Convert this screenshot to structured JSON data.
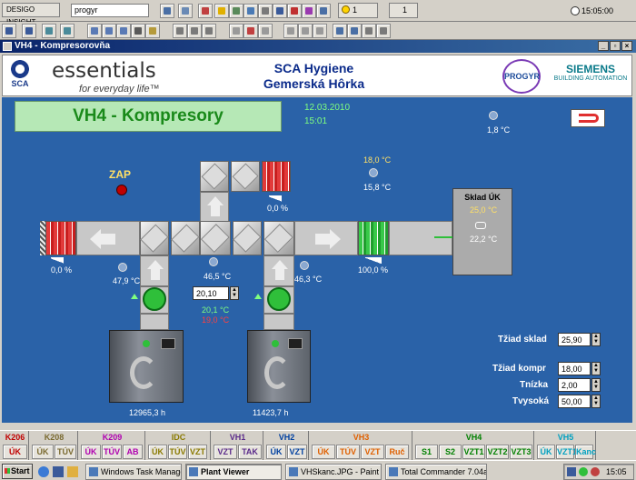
{
  "app": {
    "name": "DESIGO INSIGHT",
    "user": "progyr",
    "clock": "15:05:00",
    "alarm_count_1": "1",
    "alarm_count_2": "1"
  },
  "window": {
    "title": "VH4 - Kompresorovňa"
  },
  "header": {
    "company_line1": "SCA Hygiene",
    "company_line2": "Gemerská Hôrka",
    "essentials": "essentials",
    "tagline": "for everyday life™",
    "sca_logo": "SCA",
    "progyr_logo": "PROGYR",
    "siemens_line1": "SIEMENS",
    "siemens_line2": "BUILDING AUTOMATION"
  },
  "plant": {
    "title": "VH4 - Kompresory",
    "date": "12.03.2010",
    "time": "15:01",
    "outdoor_temp": "1,8 °C",
    "status": "ZAP",
    "damper_left": "0,0 %",
    "damper_top": "0,0 %",
    "damper_right": "100,0 %",
    "temp_top_set": "18,0 °C",
    "temp_top": "15,8 °C",
    "temp_left": "47,9 °C",
    "temp_mid": "46,5 °C",
    "temp_right": "46,3 °C",
    "mix_setpoint": "20,10",
    "mix_green": "20,1 °C",
    "mix_red": "19,0 °C",
    "storage_title": "Sklad ÚK",
    "storage_set": "25,0 °C",
    "storage_temp": "22,2 °C",
    "comp1_hours": "12965,3 h",
    "comp2_hours": "11423,7 h",
    "setpoints": [
      {
        "label": "Tžiad sklad",
        "value": "25,90"
      },
      {
        "label": "Tžiad kompr",
        "value": "18,00"
      },
      {
        "label": "Tnízka",
        "value": "2,00"
      },
      {
        "label": "Tvysoká",
        "value": "50,00"
      }
    ]
  },
  "footer": {
    "groups": [
      {
        "name": "K206",
        "color": "#c00000",
        "items": [
          "ÚK"
        ]
      },
      {
        "name": "K208",
        "color": "#7a6a30",
        "items": [
          "ÚK",
          "TÚV"
        ]
      },
      {
        "name": "K209",
        "color": "#b000b0",
        "items": [
          "ÚK",
          "TÚV",
          "AB"
        ]
      },
      {
        "name": "IDC",
        "color": "#8a7a00",
        "items": [
          "ÚK",
          "TÚV",
          "VZT"
        ]
      },
      {
        "name": "VH1",
        "color": "#5a2a8a",
        "items": [
          "VZT",
          "TAK"
        ]
      },
      {
        "name": "VH2",
        "color": "#0040a0",
        "items": [
          "ÚK",
          "VZT"
        ]
      },
      {
        "name": "VH3",
        "color": "#e06000",
        "items": [
          "ÚK",
          "TÚV",
          "VZT",
          "Ruč"
        ]
      },
      {
        "name": "VH4",
        "color": "#008000",
        "items": [
          "S1",
          "S2",
          "VZT1",
          "VZT2",
          "VZT3"
        ]
      },
      {
        "name": "VH5",
        "color": "#00a0c0",
        "items": [
          "ÚK",
          "VZT1",
          "Kanc"
        ]
      }
    ]
  },
  "taskbar": {
    "start": "Start",
    "tasks": [
      "Windows Task Manager",
      "Plant Viewer",
      "VHSkanc.JPG - Paint",
      "Total Commander 7.04a ..."
    ],
    "time": "15:05"
  },
  "colors": {
    "plant_bg": "#2a62a8",
    "title_green": "#1a8a1a",
    "accent_yellow": "#ffe066"
  }
}
